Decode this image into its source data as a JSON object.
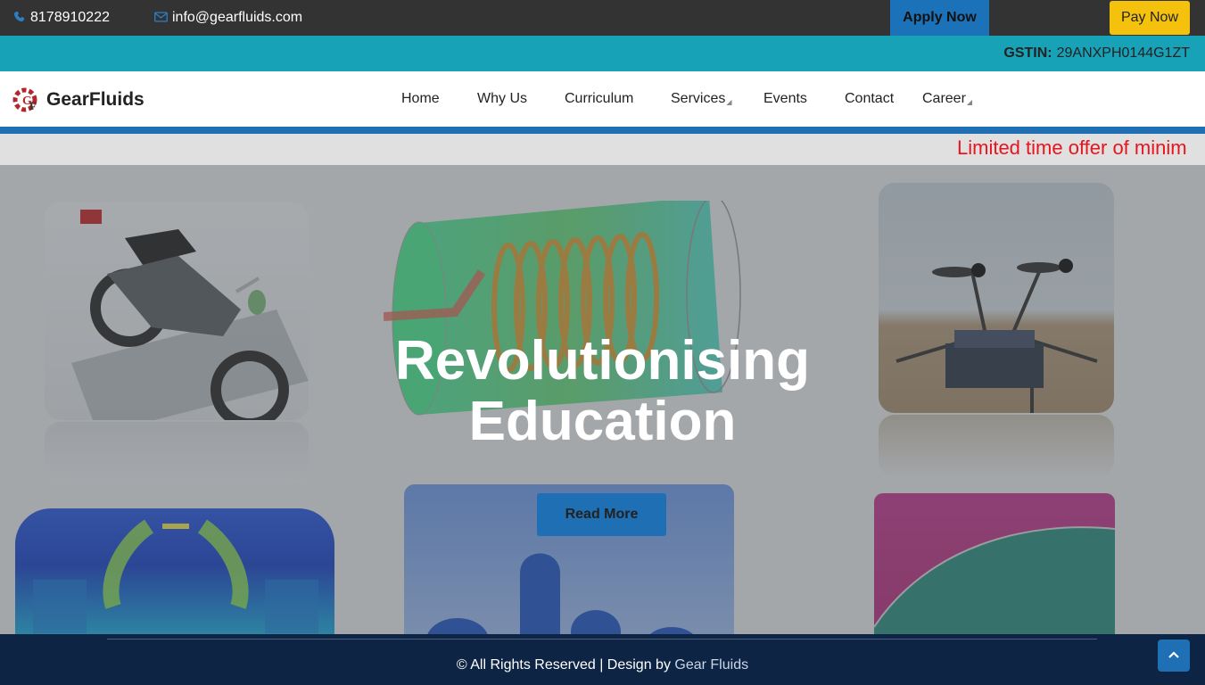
{
  "topbar": {
    "phone_icon": "phone-icon",
    "phone": "8178910222",
    "email_icon": "envelope-icon",
    "email": "info@gearfluids.com",
    "apply_label": "Apply Now",
    "pay_label": "Pay Now"
  },
  "gst": {
    "label": "GSTIN:",
    "value": "29ANXPH0144G1ZT"
  },
  "brand": {
    "name": "GearFluids",
    "logo_text": "GF"
  },
  "nav": {
    "items": [
      {
        "label": "Home"
      },
      {
        "label": "Why Us"
      },
      {
        "label": "Curriculum"
      },
      {
        "label": "Services",
        "caret": "◢"
      },
      {
        "label": "Events"
      },
      {
        "label": "Contact"
      },
      {
        "label": "Career",
        "caret": "◢"
      }
    ]
  },
  "ticker": {
    "text": "Limited time offer of minim"
  },
  "hero": {
    "title_line1": "Revolutionising",
    "title_line2": "Education",
    "button_label": "Read More"
  },
  "footer": {
    "copyright": "© All Rights Reserved | Design by ",
    "brand": "Gear Fluids",
    "top_icon": "chevron-up-icon"
  },
  "colors": {
    "topbar_bg": "#333333",
    "gst_bg": "#17a2b8",
    "accent_blue": "#1e6fb3",
    "pay_yellow": "#f4c20d",
    "ticker_red": "#e8141e",
    "footer_bg": "#0e2444"
  }
}
